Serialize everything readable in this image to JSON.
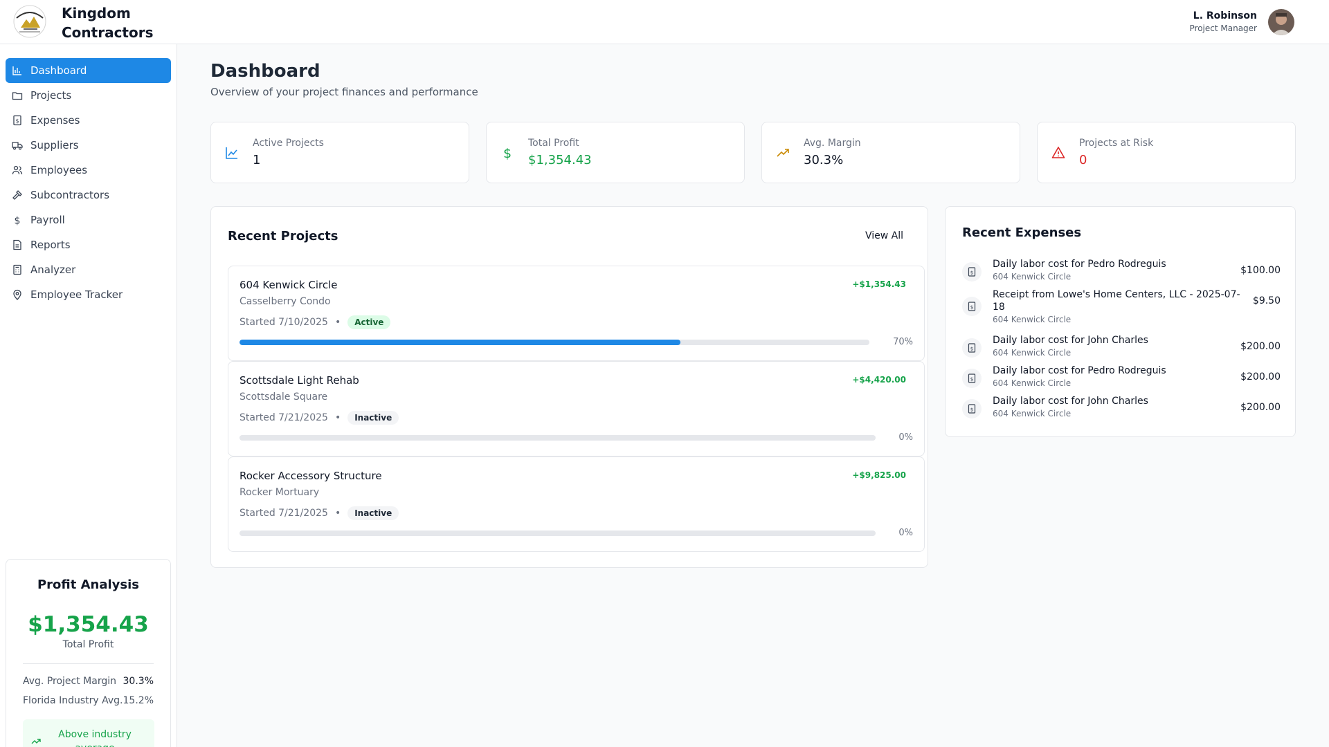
{
  "brand": {
    "line1": "Kingdom",
    "line2": "Contractors"
  },
  "user": {
    "name": "L. Robinson",
    "role": "Project Manager"
  },
  "nav": [
    {
      "label": "Dashboard",
      "icon": "bar-chart-icon",
      "active": true
    },
    {
      "label": "Projects",
      "icon": "folder-icon"
    },
    {
      "label": "Expenses",
      "icon": "receipt-icon"
    },
    {
      "label": "Suppliers",
      "icon": "truck-icon"
    },
    {
      "label": "Employees",
      "icon": "users-icon"
    },
    {
      "label": "Subcontractors",
      "icon": "hammer-icon"
    },
    {
      "label": "Payroll",
      "icon": "dollar-icon"
    },
    {
      "label": "Reports",
      "icon": "document-icon"
    },
    {
      "label": "Analyzer",
      "icon": "calculator-icon"
    },
    {
      "label": "Employee Tracker",
      "icon": "map-pin-icon"
    }
  ],
  "profit_analysis": {
    "title": "Profit Analysis",
    "amount": "$1,354.43",
    "amount_label": "Total Profit",
    "margin_label": "Avg. Project Margin",
    "margin_value": "30.3%",
    "industry_label": "Florida Industry Avg.",
    "industry_value": "15.2%",
    "badge": "Above industry average"
  },
  "page": {
    "title": "Dashboard",
    "subtitle": "Overview of your project finances and performance"
  },
  "stats": [
    {
      "label": "Active Projects",
      "value": "1",
      "icon": "line-chart-icon",
      "color": "#1e88e5"
    },
    {
      "label": "Total Profit",
      "value": "$1,354.43",
      "icon": "dollar-icon",
      "color": "#16a34a"
    },
    {
      "label": "Avg. Margin",
      "value": "30.3%",
      "icon": "trending-up-icon",
      "color": "#ca8a04"
    },
    {
      "label": "Projects at Risk",
      "value": "0",
      "icon": "warning-icon",
      "color": "#dc2626"
    }
  ],
  "recent_projects": {
    "title": "Recent Projects",
    "view_all": "View All",
    "items": [
      {
        "name": "604 Kenwick Circle",
        "client": "Casselberry Condo",
        "started": "Started 7/10/2025",
        "status": "Active",
        "profit": "+$1,354.43",
        "progress": 70,
        "progress_label": "70%"
      },
      {
        "name": "Scottsdale Light Rehab",
        "client": "Scottsdale Square",
        "started": "Started 7/21/2025",
        "status": "Inactive",
        "profit": "+$4,420.00",
        "progress": 0,
        "progress_label": "0%"
      },
      {
        "name": "Rocker Accessory Structure",
        "client": "Rocker Mortuary",
        "started": "Started 7/21/2025",
        "status": "Inactive",
        "profit": "+$9,825.00",
        "progress": 0,
        "progress_label": "0%"
      }
    ]
  },
  "recent_expenses": {
    "title": "Recent Expenses",
    "items": [
      {
        "desc": "Daily labor cost for Pedro Rodreguis",
        "project": "604 Kenwick Circle",
        "amount": "$100.00"
      },
      {
        "desc": "Receipt from Lowe's Home Centers, LLC - 2025-07-18",
        "project": "604 Kenwick Circle",
        "amount": "$9.50"
      },
      {
        "desc": "Daily labor cost for John Charles",
        "project": "604 Kenwick Circle",
        "amount": "$200.00"
      },
      {
        "desc": "Daily labor cost for Pedro Rodreguis",
        "project": "604 Kenwick Circle",
        "amount": "$200.00"
      },
      {
        "desc": "Daily labor cost for John Charles",
        "project": "604 Kenwick Circle",
        "amount": "$200.00"
      }
    ]
  }
}
